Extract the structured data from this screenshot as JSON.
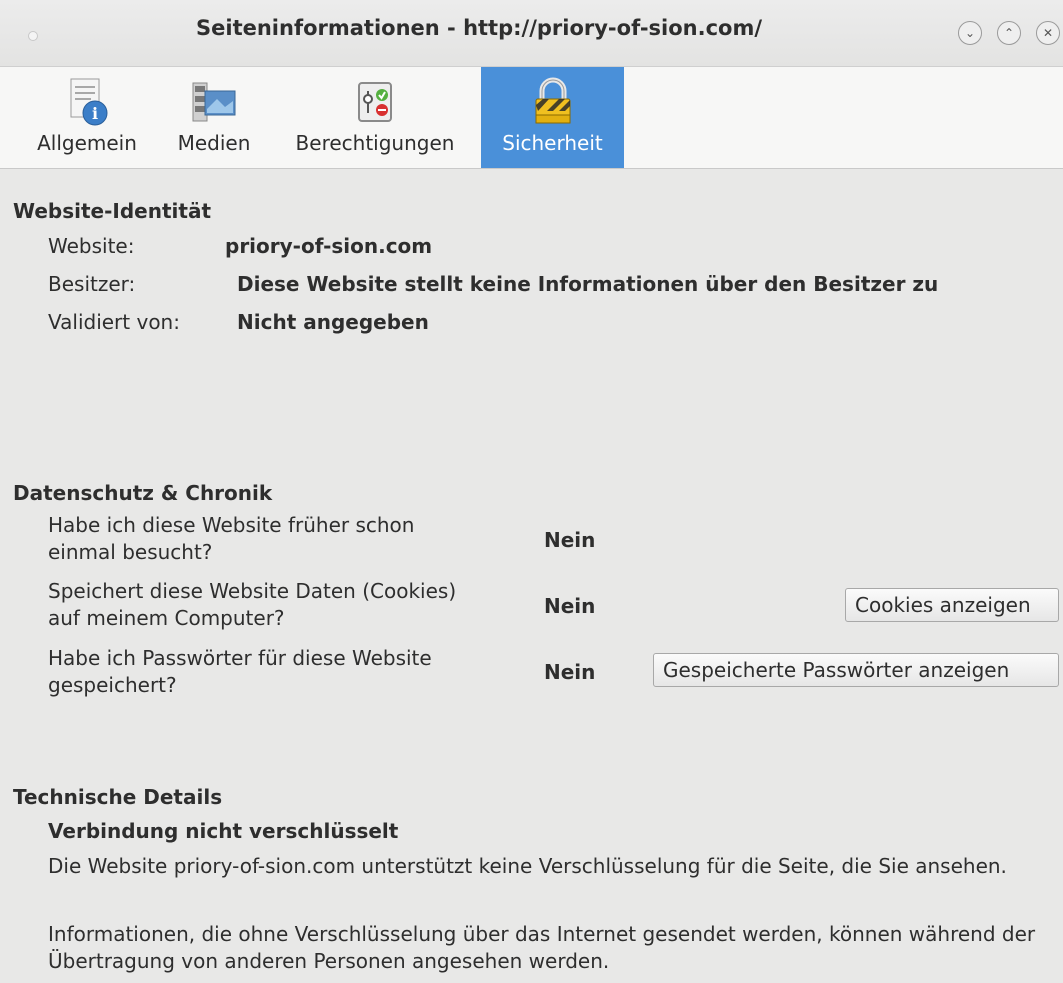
{
  "window": {
    "title": "Seiteninformationen - http://priory-of-sion.com/",
    "buttons": {
      "minimize": "⌄",
      "maximize": "⌃",
      "close": "✕"
    }
  },
  "tabs": [
    {
      "label": "Allgemein",
      "icon": "info-page-icon",
      "active": false
    },
    {
      "label": "Medien",
      "icon": "media-icon",
      "active": false
    },
    {
      "label": "Berechtigungen",
      "icon": "permissions-icon",
      "active": false
    },
    {
      "label": "Sicherheit",
      "icon": "padlock-icon",
      "active": true
    }
  ],
  "identity": {
    "heading": "Website-Identität",
    "website_label": "Website:",
    "website_value": "priory-of-sion.com",
    "owner_label": "Besitzer:",
    "owner_value": "Diese Website stellt keine Informationen über den Besitzer zu",
    "verified_label": "Validiert von:",
    "verified_value": "Nicht angegeben"
  },
  "privacy": {
    "heading": "Datenschutz & Chronik",
    "rows": [
      {
        "question": "Habe ich diese Website früher schon einmal besucht?",
        "answer": "Nein"
      },
      {
        "question": "Speichert diese Website Daten (Cookies) auf meinem Computer?",
        "answer": "Nein",
        "button": "Cookies anzeigen"
      },
      {
        "question": "Habe ich Passwörter für diese Website gespeichert?",
        "answer": "Nein",
        "button": "Gespeicherte Passwörter anzeigen"
      }
    ]
  },
  "technical": {
    "heading": "Technische Details",
    "subheading": "Verbindung nicht verschlüsselt",
    "para1": "Die Website priory-of-sion.com unterstützt keine Verschlüsselung für die Seite, die Sie ansehen.",
    "para2": "Informationen, die ohne Verschlüsselung über das Internet gesendet werden, können während der Übertragung von anderen Personen angesehen werden."
  },
  "colors": {
    "accent": "#4a90d9",
    "background": "#e8e8e7"
  }
}
